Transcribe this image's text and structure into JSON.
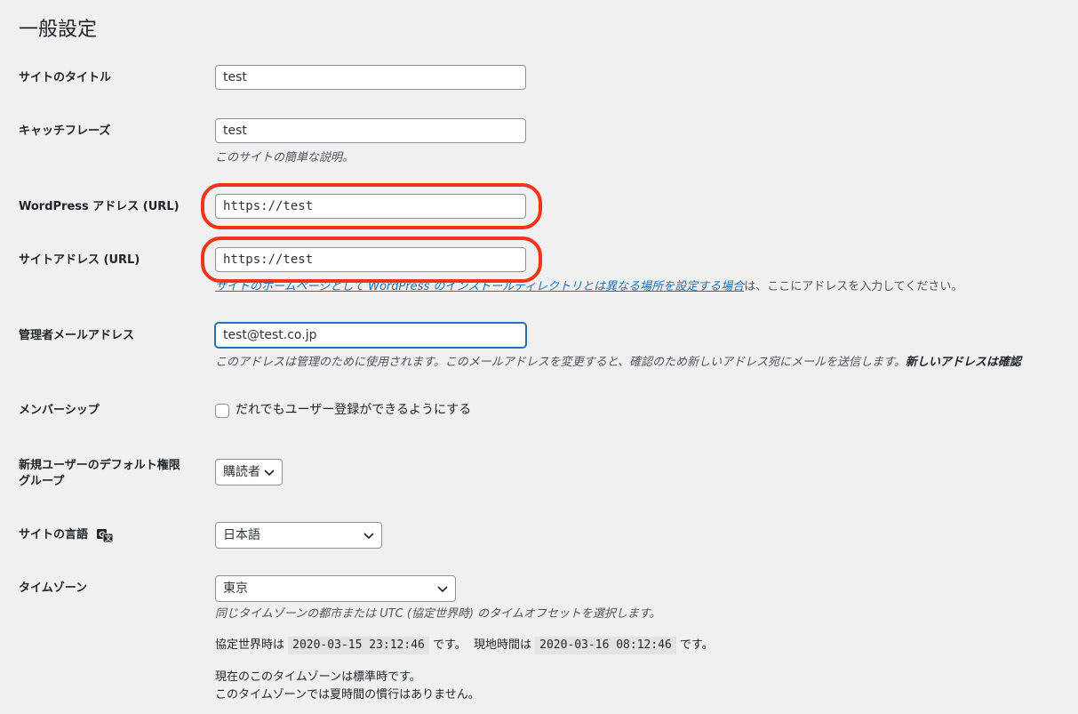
{
  "page_title": "一般設定",
  "fields": {
    "site_title": {
      "label": "サイトのタイトル",
      "value": "test"
    },
    "tagline": {
      "label": "キャッチフレーズ",
      "value": "test",
      "description": "このサイトの簡単な説明。"
    },
    "wp_address": {
      "label": "WordPress アドレス (URL)",
      "value": "https://test"
    },
    "site_address": {
      "label": "サイトアドレス (URL)",
      "value": "https://test",
      "description_link": "サイトのホームページとして WordPress のインストールディレクトリとは異なる場所を設定する場合",
      "description_rest": "は、ここにアドレスを入力してください。"
    },
    "admin_email": {
      "label": "管理者メールアドレス",
      "value": "test@test.co.jp",
      "description": "このアドレスは管理のために使用されます。このメールアドレスを変更すると、確認のため新しいアドレス宛にメールを送信します。",
      "description_bold": "新しいアドレスは確認"
    },
    "membership": {
      "label": "メンバーシップ",
      "checkbox_label": "だれでもユーザー登録ができるようにする",
      "checked": false
    },
    "default_role": {
      "label_line1": "新規ユーザーのデフォルト権限",
      "label_line2": "グループ",
      "value": "購読者"
    },
    "site_language": {
      "label": "サイトの言語",
      "value": "日本語"
    },
    "timezone": {
      "label": "タイムゾーン",
      "value": "東京",
      "description": "同じタイムゾーンの都市または UTC (協定世界時) のタイムオフセットを選択します。",
      "utc_prefix": "協定世界時は",
      "utc_time": "2020-03-15 23:12:46",
      "utc_suffix": "です。",
      "local_prefix": "現地時間は",
      "local_time": "2020-03-16 08:12:46",
      "local_suffix": "です。",
      "std_note": "現在のこのタイムゾーンは標準時です。",
      "dst_note": "このタイムゾーンでは夏時間の慣行はありません。"
    }
  },
  "colors": {
    "highlight": "#f0341c",
    "link": "#2271b1",
    "background": "#f0f0f1"
  }
}
